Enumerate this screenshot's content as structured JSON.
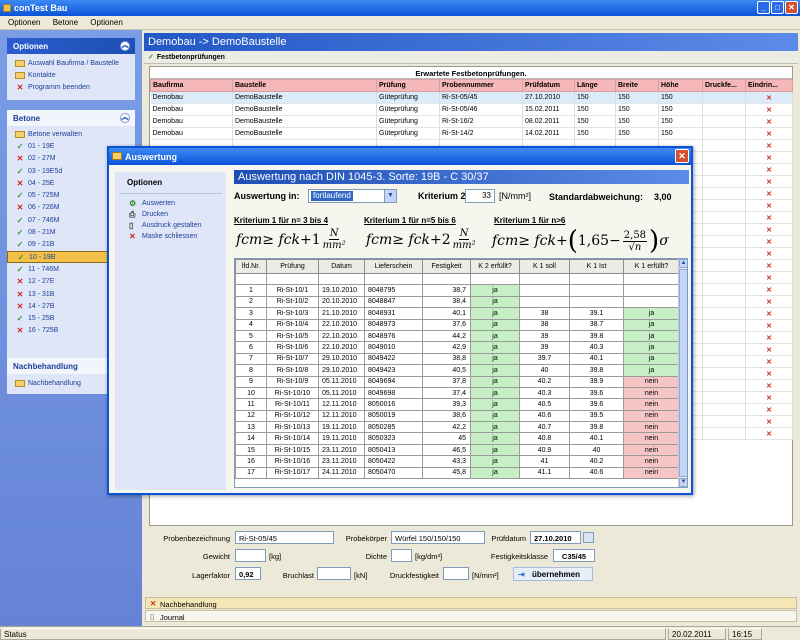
{
  "window": {
    "title": "conTest Bau"
  },
  "menu": [
    "Optionen",
    "Betone",
    "Optionen"
  ],
  "sidebar": {
    "optionen": {
      "title": "Optionen",
      "items": [
        "Auswahl Baufirma / Baustelle",
        "Kontakte",
        "Programm beenden"
      ]
    },
    "betone": {
      "title": "Betone",
      "items": [
        {
          "label": "Betone verwalten",
          "icon": "folder"
        },
        {
          "label": "01 - 19E",
          "icon": "check"
        },
        {
          "label": "02 - 27M",
          "icon": "cross"
        },
        {
          "label": "03 - 19E5d",
          "icon": "check"
        },
        {
          "label": "04 - 25E",
          "icon": "cross"
        },
        {
          "label": "05 - 725M",
          "icon": "check"
        },
        {
          "label": "06 - 726M",
          "icon": "cross"
        },
        {
          "label": "07 - 746M",
          "icon": "check"
        },
        {
          "label": "08 - 21M",
          "icon": "check"
        },
        {
          "label": "09 - 21B",
          "icon": "check"
        },
        {
          "label": "10 - 19B",
          "icon": "check",
          "selected": true
        },
        {
          "label": "11 - 746M",
          "icon": "check"
        },
        {
          "label": "12 - 27E",
          "icon": "cross"
        },
        {
          "label": "13 - 31B",
          "icon": "cross"
        },
        {
          "label": "14 - 27B",
          "icon": "cross"
        },
        {
          "label": "15 - 25B",
          "icon": "check"
        },
        {
          "label": "16 - 725B",
          "icon": "cross"
        }
      ]
    },
    "nachbehandlung": {
      "title": "Nachbehandlung",
      "items": [
        "Nachbehandlung"
      ]
    }
  },
  "main": {
    "header": "Demobau -> DemoBaustelle",
    "tab": "Festbetonprüfungen",
    "caption": "Erwartete Festbetonprüfungen.",
    "columns": [
      "Baufirma",
      "Baustelle",
      "Prüfung",
      "Probennummer",
      "Prüfdatum",
      "Länge",
      "Breite",
      "Höhe",
      "Druckfe...",
      "Eindrin..."
    ],
    "rows": [
      [
        "Demobau",
        "DemoBaustelle",
        "Güteprüfung",
        "Ri-St-05/45",
        "27.10.2010",
        "150",
        "150",
        "150",
        "",
        "✕"
      ],
      [
        "Demobau",
        "DemoBaustelle",
        "Güteprüfung",
        "Ri-St-05/46",
        "15.02.2011",
        "150",
        "150",
        "150",
        "",
        "✕"
      ],
      [
        "Demobau",
        "DemoBaustelle",
        "Güteprüfung",
        "Ri-St-16/2",
        "08.02.2011",
        "150",
        "150",
        "150",
        "",
        "✕"
      ],
      [
        "Demobau",
        "DemoBaustelle",
        "Güteprüfung",
        "Ri-St-14/2",
        "14.02.2011",
        "150",
        "150",
        "150",
        "",
        "✕"
      ],
      [
        "",
        "",
        "",
        "",
        "",
        "",
        "",
        "",
        "",
        "✕"
      ],
      [
        "",
        "",
        "",
        "",
        "",
        "",
        "",
        "",
        "",
        "✕"
      ],
      [
        "",
        "",
        "",
        "",
        "",
        "",
        "",
        "",
        "",
        "✕"
      ],
      [
        "",
        "",
        "",
        "",
        "",
        "",
        "",
        "",
        "",
        "✕"
      ],
      [
        "",
        "",
        "",
        "",
        "",
        "",
        "",
        "",
        "",
        "✕"
      ],
      [
        "",
        "",
        "",
        "",
        "",
        "",
        "",
        "",
        "",
        "✕"
      ],
      [
        "",
        "",
        "",
        "",
        "",
        "",
        "",
        "",
        "",
        "✕"
      ],
      [
        "",
        "",
        "",
        "",
        "",
        "",
        "",
        "",
        "",
        "✕"
      ],
      [
        "",
        "",
        "",
        "",
        "",
        "",
        "",
        "",
        "",
        "✕"
      ],
      [
        "",
        "",
        "",
        "",
        "",
        "",
        "",
        "",
        "",
        "✕"
      ],
      [
        "",
        "",
        "",
        "",
        "",
        "",
        "",
        "",
        "",
        "✕"
      ],
      [
        "",
        "",
        "",
        "",
        "",
        "",
        "",
        "",
        "",
        "✕"
      ],
      [
        "",
        "",
        "",
        "",
        "",
        "",
        "",
        "",
        "",
        "✕"
      ],
      [
        "",
        "",
        "",
        "",
        "",
        "",
        "",
        "",
        "",
        "✕"
      ],
      [
        "",
        "",
        "",
        "",
        "",
        "",
        "",
        "",
        "",
        "✕"
      ],
      [
        "",
        "",
        "",
        "",
        "",
        "",
        "",
        "",
        "",
        "✕"
      ],
      [
        "",
        "",
        "",
        "",
        "",
        "",
        "",
        "",
        "",
        "✕"
      ],
      [
        "",
        "",
        "",
        "",
        "",
        "",
        "",
        "",
        "",
        "✕"
      ],
      [
        "",
        "",
        "",
        "",
        "",
        "",
        "",
        "",
        "",
        "✕"
      ],
      [
        "",
        "",
        "",
        "",
        "",
        "",
        "",
        "",
        "",
        "✕"
      ],
      [
        "",
        "",
        "",
        "",
        "",
        "",
        "",
        "",
        "",
        "✕"
      ],
      [
        "",
        "",
        "",
        "",
        "",
        "",
        "",
        "",
        "",
        "✕"
      ],
      [
        "",
        "",
        "",
        "",
        "",
        "",
        "",
        "",
        "",
        "✕"
      ],
      [
        "",
        "",
        "",
        "",
        "",
        "",
        "",
        "",
        "",
        "✕"
      ],
      [
        "",
        "",
        "",
        "",
        "",
        "",
        "",
        "",
        "",
        "✕"
      ]
    ]
  },
  "form": {
    "probenbezeichnung_label": "Probenbezeichnung",
    "probenbezeichnung": "Ri-St-05/45",
    "probekoerper_label": "Probekörper",
    "probekoerper": "Würfel 150/150/150",
    "pruefdatum_label": "Prüfdatum",
    "pruefdatum": "27.10.2010",
    "gewicht_label": "Gewicht",
    "gewicht_unit": "[kg]",
    "dichte_label": "Dichte",
    "dichte_unit": "[kg/dm³]",
    "festigkeitsklasse_label": "Festigkeitsklasse",
    "festigkeitsklasse": "C35/45",
    "lagerfaktor_label": "Lagerfaktor",
    "lagerfaktor": "0,92",
    "bruchlast_label": "Bruchlast",
    "bruchlast_unit": "[kN]",
    "druckfestigkeit_label": "Druckfestigkeit",
    "druckfestigkeit_unit": "[N/mm²]",
    "uebernehmen": "übernehmen"
  },
  "sections": {
    "nachbehandlung": "Nachbehandlung",
    "journal": "Journal"
  },
  "statusbar": {
    "text": "Status",
    "date": "20.02.2011",
    "time": "16:15"
  },
  "dialog": {
    "title": "Auswertung",
    "left_title": "Optionen",
    "left_items": [
      {
        "label": "Auswerten",
        "icon": "gear"
      },
      {
        "label": "Drucken",
        "icon": "print"
      },
      {
        "label": "Ausdruck gestalten",
        "icon": "doc"
      },
      {
        "label": "Maske schliessen",
        "icon": "cross"
      }
    ],
    "header": "Auswertung nach DIN 1045-3. Sorte:  19B - C 30/37",
    "auswertung_label": "Auswertung in:",
    "auswertung_value": "fortlaufend",
    "kriterium2_label": "Kriterium 2:",
    "kriterium2_value": "33",
    "kriterium2_unit": "[N/mm²]",
    "std_label": "Standardabweichung:",
    "std_value": "3,00",
    "krit1a": "Kriterium 1 für n= 3 bis 4",
    "krit1b": "Kriterium 1 für n=5 bis 6",
    "krit1c": "Kriterium 1 für n>6",
    "f1_plus": "+1",
    "f2_plus": "+2",
    "f3_const": "1,65",
    "f3_num": "2,58",
    "columns": [
      "lfd.Nr.",
      "Prüfung",
      "Datum",
      "Lieferschein",
      "Festigkeit",
      "K 2 erfüllt?",
      "K 1 soll",
      "K 1 Ist",
      "K 1 erfüllt?"
    ],
    "rows": [
      [
        "",
        "",
        "",
        "",
        "",
        "",
        "",
        "",
        ""
      ],
      [
        "1",
        "Ri-St-10/1",
        "19.10.2010",
        "8048795",
        "38,7",
        "ja",
        "",
        "",
        ""
      ],
      [
        "2",
        "Ri-St-10/2",
        "20.10.2010",
        "8048847",
        "38,4",
        "ja",
        "",
        "",
        ""
      ],
      [
        "3",
        "Ri-St-10/3",
        "21.10.2010",
        "8048931",
        "40,1",
        "ja",
        "38",
        "39.1",
        "ja"
      ],
      [
        "4",
        "Ri-St-10/4",
        "22.10.2010",
        "8048973",
        "37,6",
        "ja",
        "38",
        "38.7",
        "ja"
      ],
      [
        "5",
        "Ri-St-10/5",
        "22.10.2010",
        "8048976",
        "44,2",
        "ja",
        "39",
        "39.8",
        "ja"
      ],
      [
        "6",
        "Ri-St-10/6",
        "22.10.2010",
        "8049010",
        "42,9",
        "ja",
        "39",
        "40.3",
        "ja"
      ],
      [
        "7",
        "Ri-St-10/7",
        "29.10.2010",
        "8049422",
        "38,8",
        "ja",
        "39.7",
        "40.1",
        "ja"
      ],
      [
        "8",
        "Ri-St-10/8",
        "29.10.2010",
        "8049423",
        "40,5",
        "ja",
        "40",
        "39.8",
        "ja"
      ],
      [
        "9",
        "Ri-St-10/9",
        "05.11.2010",
        "8049694",
        "37,8",
        "ja",
        "40.2",
        "39.9",
        "nein"
      ],
      [
        "10",
        "Ri-St-10/10",
        "05.11.2010",
        "8049698",
        "37,4",
        "ja",
        "40.3",
        "39.6",
        "nein"
      ],
      [
        "11",
        "Ri-St-10/11",
        "12.11.2010",
        "8050016",
        "39,3",
        "ja",
        "40.5",
        "39.6",
        "nein"
      ],
      [
        "12",
        "Ri-St-10/12",
        "12.11.2010",
        "8050019",
        "38,6",
        "ja",
        "40.6",
        "39.5",
        "nein"
      ],
      [
        "13",
        "Ri-St-10/13",
        "19.11.2010",
        "8050285",
        "42,2",
        "ja",
        "40.7",
        "39.8",
        "nein"
      ],
      [
        "14",
        "Ri-St-10/14",
        "19.11.2010",
        "8050323",
        "45",
        "ja",
        "40.8",
        "40.1",
        "nein"
      ],
      [
        "15",
        "Ri-St-10/15",
        "23.11.2010",
        "8050413",
        "46,5",
        "ja",
        "40.9",
        "40",
        "nein"
      ],
      [
        "16",
        "Ri-St-10/16",
        "23.11.2010",
        "8050422",
        "43,3",
        "ja",
        "41",
        "40.2",
        "nein"
      ],
      [
        "17",
        "Ri-St-10/17",
        "24.11.2010",
        "8050470",
        "45,8",
        "ja",
        "41.1",
        "40.6",
        "nein"
      ]
    ]
  }
}
